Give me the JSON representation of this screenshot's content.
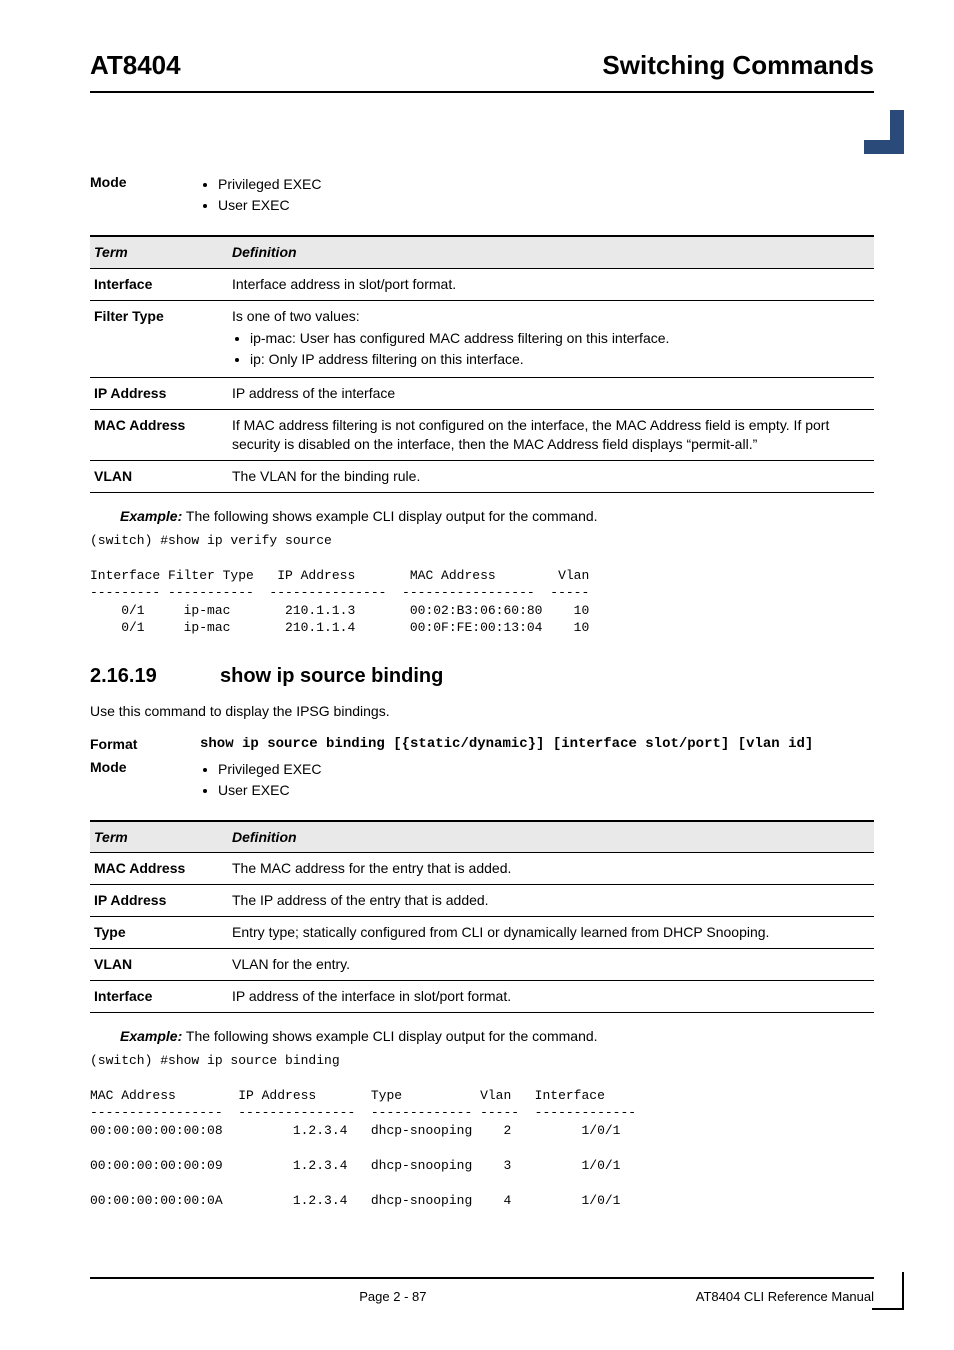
{
  "header": {
    "left": "AT8404",
    "right": "Switching Commands"
  },
  "mode1": {
    "label": "Mode",
    "items": [
      "Privileged EXEC",
      "User EXEC"
    ]
  },
  "table1": {
    "head": {
      "c1": "Term",
      "c2": "Definition"
    },
    "rows": [
      {
        "term": "Interface",
        "def": "Interface address in slot/port format."
      },
      {
        "term": "Filter Type",
        "def_intro": "Is one of two values:",
        "bullets": [
          "ip-mac: User has configured MAC address filtering on this interface.",
          "ip: Only IP address filtering on this interface."
        ]
      },
      {
        "term": "IP Address",
        "def": "IP address of the interface"
      },
      {
        "term": "MAC Address",
        "def": "If MAC address filtering is not configured on the interface, the MAC Address field is empty. If port security is disabled on the interface, then the MAC Address field displays “permit-all.”"
      },
      {
        "term": "VLAN",
        "def": "The VLAN for the binding rule."
      }
    ]
  },
  "example1": {
    "bold": "Example:",
    "text": " The following shows example CLI display output for the command."
  },
  "cli1": "(switch) #show ip verify source\n\nInterface Filter Type   IP Address       MAC Address        Vlan\n--------- -----------  ---------------  -----------------  -----\n    0/1     ip-mac       210.1.1.3       00:02:B3:06:60:80    10\n    0/1     ip-mac       210.1.1.4       00:0F:FE:00:13:04    10",
  "section2": {
    "num": "2.16.19",
    "title": "show ip source binding"
  },
  "section2_body": "Use this command to display the IPSG bindings.",
  "format2": {
    "label": "Format",
    "cmd": "show ip source binding [{static/dynamic}] [interface slot/port] [vlan id]"
  },
  "mode2": {
    "label": "Mode",
    "items": [
      "Privileged EXEC",
      "User EXEC"
    ]
  },
  "table2": {
    "head": {
      "c1": "Term",
      "c2": "Definition"
    },
    "rows": [
      {
        "term": "MAC Address",
        "def": "The MAC address for the entry that is added."
      },
      {
        "term": "IP Address",
        "def": "The IP address of the entry that is added."
      },
      {
        "term": "Type",
        "def": "Entry type; statically configured from CLI or dynamically learned from DHCP Snooping."
      },
      {
        "term": "VLAN",
        "def": "VLAN for the entry."
      },
      {
        "term": "Interface",
        "def": "IP address of the interface in slot/port format."
      }
    ]
  },
  "example2": {
    "bold": "Example:",
    "text": " The following shows example CLI display output for the command."
  },
  "cli2": "(switch) #show ip source binding\n\nMAC Address        IP Address       Type          Vlan   Interface\n-----------------  ---------------  ------------- -----  -------------\n00:00:00:00:00:08         1.2.3.4   dhcp-snooping    2         1/0/1\n\n00:00:00:00:00:09         1.2.3.4   dhcp-snooping    3         1/0/1\n\n00:00:00:00:00:0A         1.2.3.4   dhcp-snooping    4         1/0/1",
  "footer": {
    "page": "Page 2 - 87",
    "manual": "AT8404 CLI Reference Manual"
  }
}
